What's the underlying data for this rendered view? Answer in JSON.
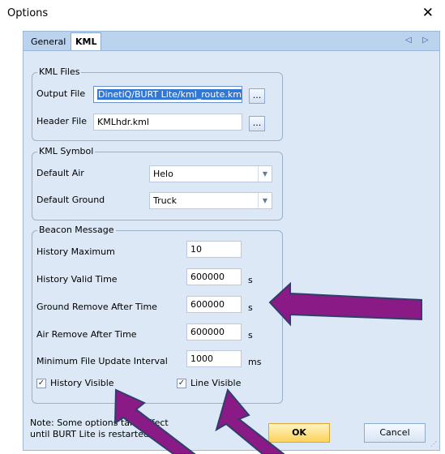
{
  "window": {
    "title": "Options",
    "close_glyph": "✕"
  },
  "tabs": [
    {
      "label": "General",
      "selected": false
    },
    {
      "label": "KML",
      "selected": true
    }
  ],
  "tab_nav": {
    "prev_glyph": "◁",
    "next_glyph": "▷"
  },
  "kml_files": {
    "legend": "KML Files",
    "output_file_label": "Output File",
    "output_file_value": "DinetiQ/BURT Lite/kml_route.kml",
    "header_file_label": "Header File",
    "header_file_value": "KMLhdr.kml",
    "browse_label": "..."
  },
  "kml_symbol": {
    "legend": "KML Symbol",
    "default_air_label": "Default Air",
    "default_air_value": "Helo",
    "default_ground_label": "Default Ground",
    "default_ground_value": "Truck",
    "dropdown_glyph": "▼"
  },
  "beacon": {
    "legend": "Beacon Message",
    "history_max_label": "History Maximum",
    "history_max_value": "10",
    "history_valid_label": "History Valid Time",
    "history_valid_value": "600000",
    "history_valid_unit": "s",
    "ground_remove_label": "Ground Remove After Time",
    "ground_remove_value": "600000",
    "ground_remove_unit": "s",
    "air_remove_label": "Air Remove After Time",
    "air_remove_value": "600000",
    "air_remove_unit": "s",
    "min_update_label": "Minimum File Update Interval",
    "min_update_value": "1000",
    "min_update_unit": "ms",
    "history_visible_label": "History Visible",
    "history_visible_checked": true,
    "line_visible_label": "Line Visible",
    "line_visible_checked": true,
    "check_glyph": "✓"
  },
  "footer": {
    "note_line1": "Note: Some options take effect",
    "note_line2": "until BURT Lite is restarted",
    "ok_label": "OK",
    "cancel_label": "Cancel"
  },
  "annotation_colors": {
    "arrow_fill": "#8a1a86",
    "arrow_stroke": "#2d3f6a"
  }
}
